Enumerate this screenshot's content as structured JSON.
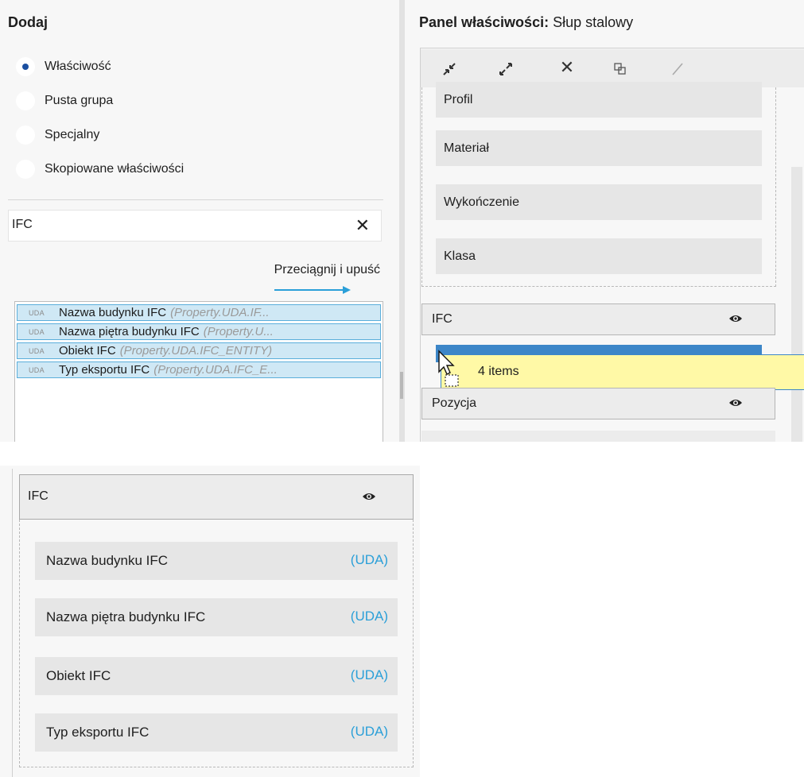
{
  "left_panel": {
    "title": "Dodaj",
    "radio_options": [
      {
        "label": "Właściwość",
        "checked": true
      },
      {
        "label": "Pusta grupa",
        "checked": false
      },
      {
        "label": "Specjalny",
        "checked": false
      },
      {
        "label": "Skopiowane właściwości",
        "checked": false
      }
    ],
    "search": {
      "value": "IFC",
      "clear_icon": "close-icon"
    },
    "drag_hint": "Przeciągnij i upuść",
    "list_items": [
      {
        "tag": "UDA",
        "name": "Nazwa budynku IFC",
        "prop": "(Property.UDA.IF..."
      },
      {
        "tag": "UDA",
        "name": "Nazwa piętra budynku IFC",
        "prop": "(Property.U..."
      },
      {
        "tag": "UDA",
        "name": "Obiekt IFC",
        "prop": "(Property.UDA.IFC_ENTITY)"
      },
      {
        "tag": "UDA",
        "name": "Typ eksportu IFC",
        "prop": "(Property.UDA.IFC_E..."
      }
    ]
  },
  "right_panel": {
    "title_bold": "Panel właściwości:",
    "title_rest": " Słup stalowy",
    "toolbar_icons": [
      "collapse-all-icon",
      "expand-all-icon",
      "delete-icon",
      "copy-icon",
      "edit-icon"
    ],
    "group_items": [
      "Profil",
      "Materiał",
      "Wykończenie",
      "Klasa"
    ],
    "ifc_group": {
      "label": "IFC",
      "icon": "eye-icon"
    },
    "drag_tooltip": "4 items",
    "position_group": {
      "label": "Pozycja",
      "icon": "eye-icon"
    }
  },
  "result_panel": {
    "group_label": "IFC",
    "group_icon": "eye-icon",
    "items": [
      {
        "name": "Nazwa budynku IFC",
        "tag": "(UDA)"
      },
      {
        "name": "Nazwa piętra budynku IFC",
        "tag": "(UDA)"
      },
      {
        "name": "Obiekt IFC",
        "tag": "(UDA)"
      },
      {
        "name": "Typ eksportu IFC",
        "tag": "(UDA)"
      }
    ]
  },
  "colors": {
    "selection_fill": "#cfe8f5",
    "selection_border": "#5aaedb",
    "accent_blue": "#2a9fd8",
    "tooltip_fill": "#fff9a6",
    "radio_dot": "#1a4fa0"
  }
}
